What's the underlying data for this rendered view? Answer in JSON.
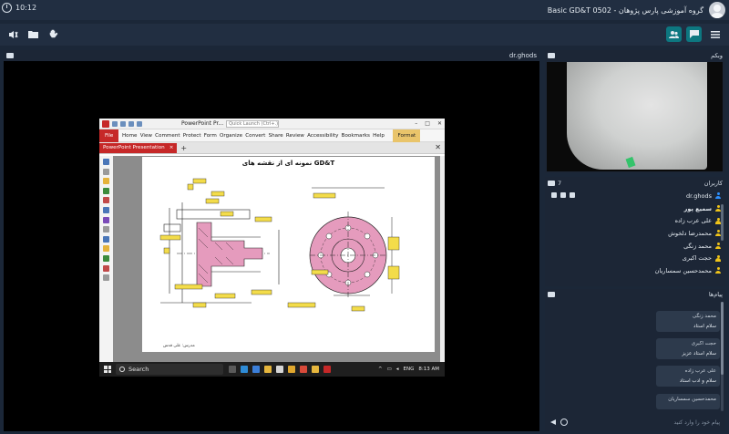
{
  "app": {
    "clock": "10:12",
    "title": "Basic GD&T 0502 - گروه آموزشی پارس پژوهان"
  },
  "toolbar": {
    "left_icons": [
      "volume-icon",
      "folder-icon",
      "hand-icon"
    ],
    "right_icons": [
      "users-icon",
      "chat-icon",
      "menu-icon"
    ]
  },
  "main": {
    "owner": "dr.ghods"
  },
  "shared_screen": {
    "app_name": "PowerPoint Pr...",
    "search_placeholder": "Quick Launch (Ctrl+.)",
    "ribbon_tabs": [
      "File",
      "Home",
      "View",
      "Comment",
      "Protect",
      "Form",
      "Organize",
      "Convert",
      "Share",
      "Review",
      "Accessibility",
      "Bookmarks",
      "Help"
    ],
    "format_tab": "Format",
    "doc_tab": "PowerPoint Presentation",
    "page_title": "نمونه ای از نقشه های GD&T",
    "page_footer": "مدرس: علی قدس",
    "taskbar_search": "Search",
    "tray_lang": "ENG",
    "tray_time": "8:13 AM"
  },
  "webcam": {
    "label": "وبکم"
  },
  "participants": {
    "label": "کاربران",
    "count": "7",
    "users": [
      {
        "name": "dr.ghods",
        "role": "host",
        "bold": false
      },
      {
        "name": "سمیع پور",
        "role": "guest",
        "bold": true
      },
      {
        "name": "علی عرب زاده",
        "role": "guest",
        "bold": false
      },
      {
        "name": "محمدرضا دلخوش",
        "role": "guest",
        "bold": false
      },
      {
        "name": "محمد زنگی",
        "role": "guest",
        "bold": false
      },
      {
        "name": "حجت اکبری",
        "role": "guest",
        "bold": false
      },
      {
        "name": "محمدحسین سمساریان",
        "role": "guest",
        "bold": false
      }
    ]
  },
  "messages": {
    "label": "پیام‌ها",
    "items": [
      {
        "sender": "محمد زنگی",
        "text": "سلام استاد"
      },
      {
        "sender": "حجت اکبری",
        "text": "سلام استاد عزیز"
      },
      {
        "sender": "علی عرب زاده",
        "text": "سلام و ادب استاد"
      },
      {
        "sender": "محمدحسین سمساریان",
        "text": ""
      }
    ],
    "input_placeholder": "پیام خود را وارد کنید"
  },
  "colors": {
    "background": "#1b2738",
    "panel": "#1c2636",
    "accent": "#0d7780",
    "file_tab": "#c62828"
  }
}
